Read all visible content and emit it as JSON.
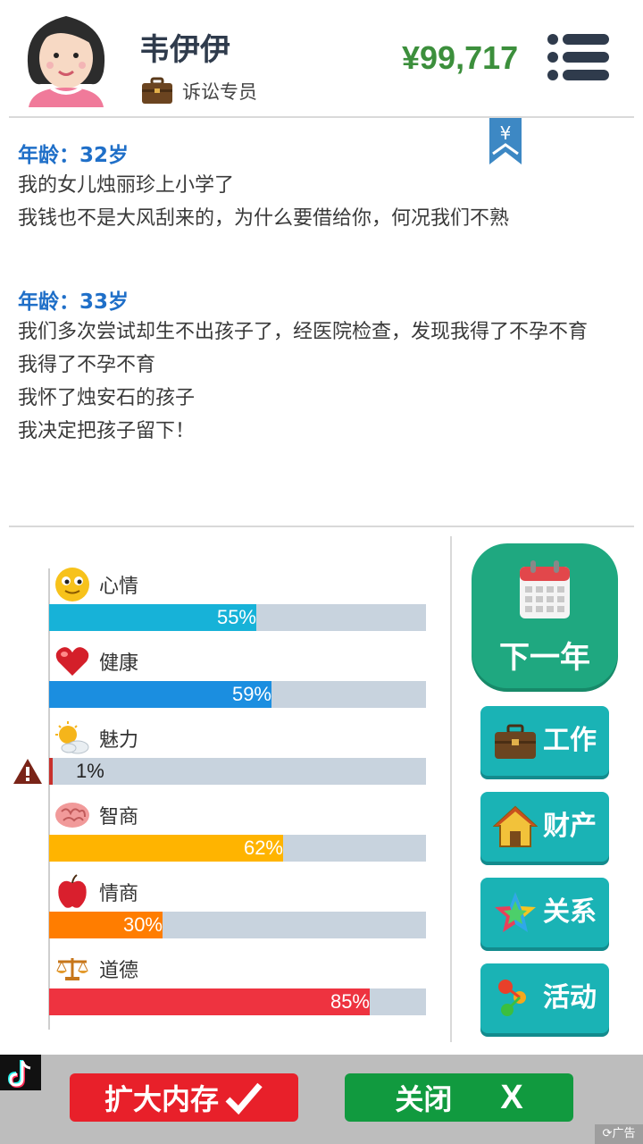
{
  "header": {
    "name": "韦伊伊",
    "job": "诉讼专员",
    "money": "¥99,717"
  },
  "bookmark_symbol": "¥",
  "log": [
    {
      "age": "年龄：32岁",
      "events": [
        "我的女儿烛丽珍上小学了",
        "我钱也不是大风刮来的，为什么要借给你，何况我们不熟"
      ]
    },
    {
      "age": "年龄：33岁",
      "events": [
        "我们多次尝试却生不出孩子了，经医院检查，发现我得了不孕不育",
        "我得了不孕不育",
        "我怀了烛安石的孩子",
        "我决定把孩子留下！"
      ]
    }
  ],
  "stats": [
    {
      "label": "心情",
      "value": 55,
      "text": "55%",
      "color": "#17b2d8",
      "icon": "smiley-icon"
    },
    {
      "label": "健康",
      "value": 59,
      "text": "59%",
      "color": "#1b8ee0",
      "icon": "heart-icon"
    },
    {
      "label": "魅力",
      "value": 1,
      "text": "1%",
      "color": "#c8302c",
      "icon": "sun-cloud-icon"
    },
    {
      "label": "智商",
      "value": 62,
      "text": "62%",
      "color": "#ffb400",
      "icon": "brain-icon"
    },
    {
      "label": "情商",
      "value": 30,
      "text": "30%",
      "color": "#ff7d00",
      "icon": "apple-icon"
    },
    {
      "label": "道德",
      "value": 85,
      "text": "85%",
      "color": "#ee3340",
      "icon": "scales-icon"
    }
  ],
  "actions": {
    "next_year": "下一年",
    "work": "工作",
    "assets": "财产",
    "relations": "关系",
    "activities": "活动"
  },
  "ad": {
    "expand": "扩大内存",
    "close": "关闭",
    "close_mark": "X",
    "tag": "广告"
  }
}
